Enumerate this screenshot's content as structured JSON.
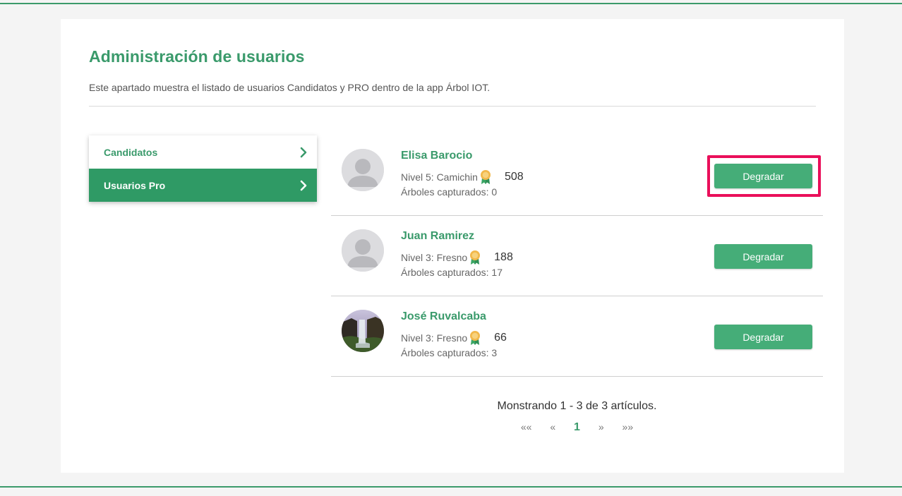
{
  "header": {
    "title": "Administración de usuarios",
    "description": "Este apartado muestra el listado de usuarios Candidatos y PRO dentro de la app Árbol IOT."
  },
  "sidebar": {
    "items": [
      {
        "label": "Candidatos",
        "active": false
      },
      {
        "label": "Usuarios Pro",
        "active": true
      }
    ]
  },
  "users": [
    {
      "name": "Elisa Barocio",
      "level": "Nivel 5: Camichin",
      "points": "508",
      "trees": "Árboles capturados: 0",
      "button": "Degradar",
      "avatar": "default-avatar"
    },
    {
      "name": "Juan Ramirez",
      "level": "Nivel 3: Fresno",
      "points": "188",
      "trees": "Árboles capturados: 17",
      "button": "Degradar",
      "avatar": "default-avatar"
    },
    {
      "name": "José Ruvalcaba",
      "level": "Nivel 3: Fresno",
      "points": "66",
      "trees": "Árboles capturados: 3",
      "button": "Degradar",
      "avatar": "photo-waterfall"
    }
  ],
  "pagination": {
    "summary": "Monstrando 1 - 3 de 3 artículos.",
    "first": "««",
    "prev": "«",
    "current": "1",
    "next": "»",
    "last": "»»"
  },
  "colors": {
    "accent": "#3a9a6b",
    "active_menu": "#2f9a65",
    "button": "#45ad78",
    "highlight": "#ea0f5a"
  }
}
